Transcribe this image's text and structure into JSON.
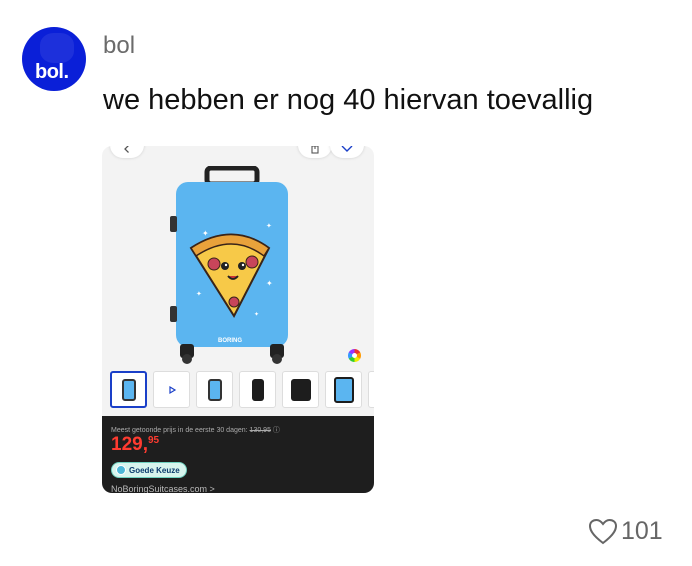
{
  "post": {
    "avatar_text": "bol",
    "username": "bol",
    "text": "we hebben er nog 40 hiervan toevallig",
    "likes": "101"
  },
  "product": {
    "brand_on_case": "BORING",
    "price_note_prefix": "Meest getoonde prijs in de eerste 30 dagen:",
    "price_note_old": "130,95",
    "price_whole": "129,",
    "price_cents": "95",
    "badge": "Goede Keuze",
    "seller": "NoBoringSuitcases.com >"
  },
  "colors": {
    "avatar_bg": "#0a1fd8",
    "case_blue": "#5bb5f0",
    "price_red": "#ff3b30",
    "panel_bg": "#1e1e1e"
  },
  "icons": [
    "back-chevron-icon",
    "share-icon",
    "dropdown-chevron-icon",
    "play-icon",
    "color-wheel-icon",
    "heart-icon",
    "info-icon"
  ]
}
